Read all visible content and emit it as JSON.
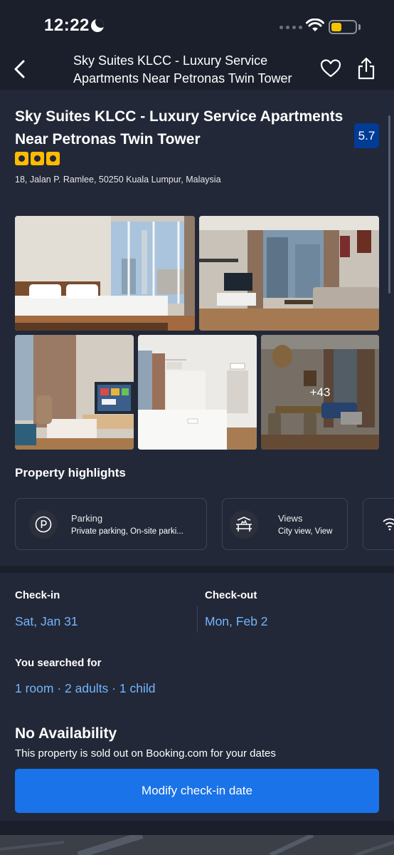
{
  "status_bar": {
    "time": "12:22"
  },
  "nav": {
    "title": "Sky Suites KLCC - Luxury Service Apartments Near Petronas Twin Tower"
  },
  "hotel": {
    "name": "Sky Suites KLCC - Luxury Service Apartments Near Petronas Twin Tower",
    "score": "5.7",
    "star_count": 3,
    "address": "18, Jalan P. Ramlee, 50250 Kuala Lumpur, Malaysia"
  },
  "gallery": {
    "more_label": "+43"
  },
  "highlights": {
    "title": "Property highlights",
    "items": [
      {
        "label": "Parking",
        "value": "Private parking, On-site parki...",
        "icon": "parking-icon"
      },
      {
        "label": "Views",
        "value": "City view, View",
        "icon": "view-icon"
      },
      {
        "label": "",
        "value": "",
        "icon": "wifi-icon"
      }
    ]
  },
  "booking": {
    "checkin_label": "Check-in",
    "checkin_value": "Sat, Jan 31",
    "checkout_label": "Check-out",
    "checkout_value": "Mon, Feb 2",
    "search_label": "You searched for",
    "search_value": "1 room · 2 adults · 1 child",
    "no_avail_title": "No Availability",
    "no_avail_text": "This property is sold out on Booking.com for your dates",
    "modify_button": "Modify check-in date"
  },
  "colors": {
    "accent": "#1a73e8",
    "link": "#74b4ff",
    "score_bg": "#003b95",
    "star": "#febb02"
  }
}
